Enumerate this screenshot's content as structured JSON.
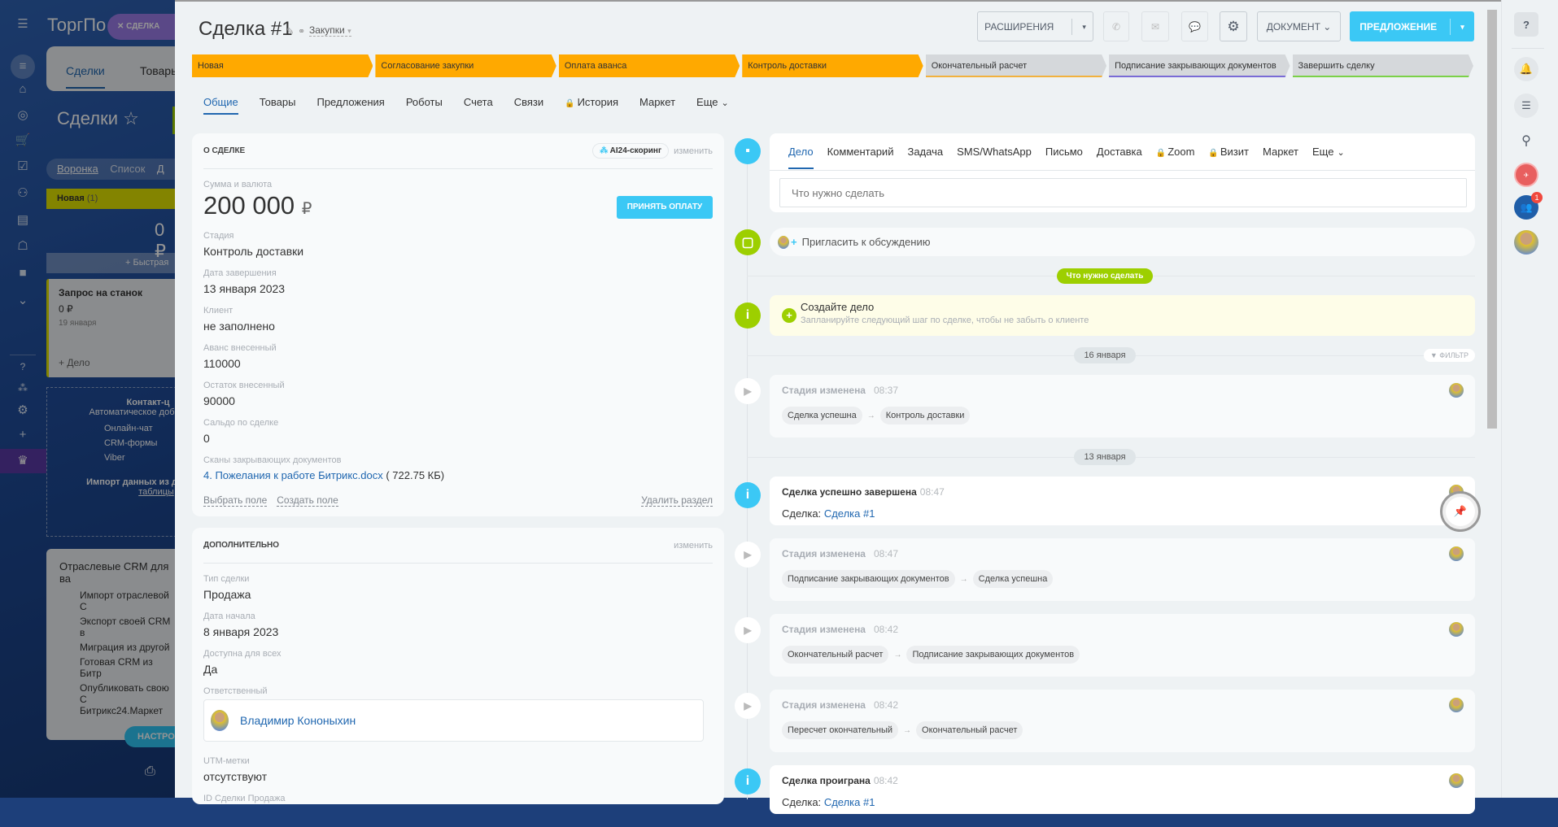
{
  "background": {
    "logo": "ТоргПо",
    "pill_label": "СДЕЛКА",
    "tabs": [
      "Сделки",
      "Товары"
    ],
    "page_title": "Сделки",
    "views": [
      "Воронка",
      "Список",
      "Д"
    ],
    "column": {
      "name": "Новая",
      "count": "(1)",
      "sum": "0 ₽",
      "quick_add": "+ Быстрая"
    },
    "deal_card": {
      "title": "Запрос на станок",
      "sum": "0 ₽",
      "date": "19 января",
      "add": "+ Дело"
    },
    "contact_box": {
      "title": "Контакт-ц",
      "subtitle": "Автоматическое доб",
      "items": [
        "Онлайн-чат",
        "CRM-формы",
        "Viber"
      ],
      "import": "Импорт данных из д",
      "import_link": "таблицы"
    },
    "crm_box": {
      "title": "Отраслевые CRM для ва",
      "items": [
        "Импорт отраслевой С",
        "Экспорт своей CRM в",
        "Миграция из другой",
        "Готовая CRM из Битр",
        "Опубликовать свою С"
      ],
      "tail": "Битрикс24.Маркет",
      "button": "НАСТРО"
    }
  },
  "header": {
    "title": "Сделка #1",
    "category": "Закупки",
    "extensions": "РАСШИРЕНИЯ",
    "document": "ДОКУМЕНТ",
    "proposal": "ПРЕДЛОЖЕНИЕ"
  },
  "stages": [
    {
      "label": "Новая",
      "color": "#ffa900",
      "active": true
    },
    {
      "label": "Согласование закупки",
      "color": "#ffa900",
      "active": true
    },
    {
      "label": "Оплата аванса",
      "color": "#ffa900",
      "active": true
    },
    {
      "label": "Контроль доставки",
      "color": "#ffa900",
      "active": true
    },
    {
      "label": "Окончательный расчет",
      "color": "#f2b13e",
      "active": false
    },
    {
      "label": "Подписание закрывающих документов",
      "color": "#7a6bd6",
      "active": false
    },
    {
      "label": "Завершить сделку",
      "color": "#7bd148",
      "active": false
    }
  ],
  "tabs": [
    "Общие",
    "Товары",
    "Предложения",
    "Роботы",
    "Счета",
    "Связи",
    "История",
    "Маркет",
    "Еще"
  ],
  "about": {
    "header": "О СДЕЛКЕ",
    "scoring": "AI24-скоринг",
    "edit": "изменить",
    "amount_label": "Сумма и валюта",
    "amount": "200 000",
    "currency": "₽",
    "accept_payment": "ПРИНЯТЬ ОПЛАТУ",
    "fields": [
      {
        "label": "Стадия",
        "value": "Контроль доставки"
      },
      {
        "label": "Дата завершения",
        "value": "13 января 2023"
      },
      {
        "label": "Клиент",
        "value": "не заполнено"
      },
      {
        "label": "Аванс внесенный",
        "value": "110000"
      },
      {
        "label": "Остаток внесенный",
        "value": "90000"
      },
      {
        "label": "Сальдо по сделке",
        "value": "0"
      }
    ],
    "scans_label": "Сканы закрывающих документов",
    "scan_file": "4. Пожелания к работе Битрикс.docx",
    "scan_size": "( 722.75 КБ)",
    "select_field": "Выбрать поле",
    "create_field": "Создать поле",
    "delete_section": "Удалить раздел"
  },
  "extra": {
    "header": "ДОПОЛНИТЕЛЬНО",
    "edit": "изменить",
    "fields": [
      {
        "label": "Тип сделки",
        "value": "Продажа"
      },
      {
        "label": "Дата начала",
        "value": "8 января 2023"
      },
      {
        "label": "Доступна для всех",
        "value": "Да"
      }
    ],
    "responsible_label": "Ответственный",
    "responsible": "Владимир Кононыхин",
    "utm_label": "UTM-метки",
    "utm": "отсутствуют",
    "id_label": "ID Сделки Продажа"
  },
  "composer": {
    "tabs": [
      "Дело",
      "Комментарий",
      "Задача",
      "SMS/WhatsApp",
      "Письмо",
      "Доставка",
      "Zoom",
      "Визит",
      "Маркет",
      "Еще"
    ],
    "placeholder": "Что нужно сделать"
  },
  "invite": "Пригласить к обсуждению",
  "todo_pill": "Что нужно сделать",
  "create_task": {
    "title": "Создайте дело",
    "subtitle": "Запланируйте следующий шаг по сделке, чтобы не забыть о клиенте"
  },
  "filter": "ФИЛЬТР",
  "timeline": [
    {
      "kind": "date",
      "label": "16 января"
    },
    {
      "kind": "stage",
      "title": "Стадия изменена",
      "time": "08:37",
      "from": "Сделка успешна",
      "to": "Контроль доставки"
    },
    {
      "kind": "date",
      "label": "13 января"
    },
    {
      "kind": "info",
      "title": "Сделка успешно завершена",
      "time": "08:47",
      "prefix": "Сделка:",
      "link": "Сделка #1",
      "pinned": true
    },
    {
      "kind": "stage",
      "title": "Стадия изменена",
      "time": "08:47",
      "from": "Подписание закрывающих документов",
      "to": "Сделка успешна"
    },
    {
      "kind": "stage",
      "title": "Стадия изменена",
      "time": "08:42",
      "from": "Окончательный расчет",
      "to": "Подписание закрывающих документов"
    },
    {
      "kind": "stage",
      "title": "Стадия изменена",
      "time": "08:42",
      "from": "Пересчет окончательный",
      "to": "Окончательный расчет"
    },
    {
      "kind": "info",
      "title": "Сделка проиграна",
      "time": "08:42",
      "prefix": "Сделка:",
      "link": "Сделка #1"
    }
  ],
  "right_sidebar": {
    "badge": "1"
  },
  "colors": {
    "accent": "#3bc8f5",
    "green": "#9dcf00",
    "link": "#2067b0"
  }
}
